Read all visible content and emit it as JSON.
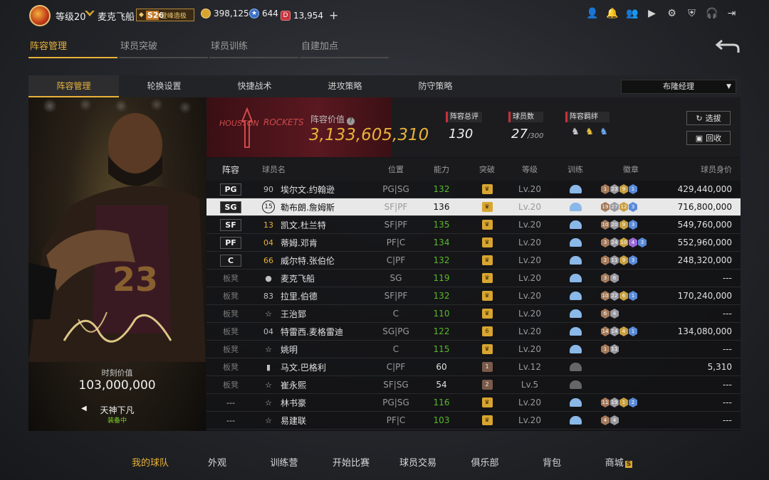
{
  "user": {
    "level": "等级20",
    "nickname": "麦克飞船",
    "season_num": "S26",
    "season_label": "登峰造极"
  },
  "currency": {
    "gold": "398,125",
    "stars": "644",
    "ruby": "13,954"
  },
  "main_tabs": [
    "阵容管理",
    "球员突破",
    "球员训练",
    "自建加点"
  ],
  "sub_tabs": [
    "阵容管理",
    "轮换设置",
    "快捷战术",
    "进攻策略",
    "防守策略"
  ],
  "coach_select": "布隆经理",
  "card": {
    "value_label": "时刻价值",
    "value": "103,000,000",
    "name": "天神下凡",
    "status": "装备中",
    "jersey": "23"
  },
  "team": {
    "logo_left": "HOUSTON",
    "logo_right": "ROCKETS",
    "lineup_label": "阵容价值",
    "lineup_value": "3,133,605,310",
    "rating_label": "阵容总评",
    "rating": "130",
    "count_label": "球员数",
    "count": "27",
    "count_max": "/300",
    "bond_label": "阵容羁绊",
    "btn_pick": "选拔",
    "btn_recycle": "回收"
  },
  "columns": [
    "阵容",
    "球员名",
    "位置",
    "能力",
    "突破",
    "等级",
    "训练",
    "徽章",
    "球员身价"
  ],
  "players": [
    {
      "slot": "PG",
      "num": "90",
      "name": "埃尔文.约翰逊",
      "pos": "PG|SG",
      "ability": "132",
      "ab_color": "green",
      "level": "Lv.20",
      "badges": [
        [
          "b",
          "1"
        ],
        [
          "s",
          "23"
        ],
        [
          "g",
          "9"
        ],
        [
          "h",
          "1"
        ]
      ],
      "value": "429,440,000"
    },
    {
      "slot": "SG",
      "num": "15",
      "name": "勒布朗.詹姆斯",
      "pos": "SF|PF",
      "ability": "136",
      "ab_color": "white",
      "level": "Lv.20",
      "badges": [
        [
          "b",
          "19"
        ],
        [
          "s",
          "27"
        ],
        [
          "g",
          "12"
        ],
        [
          "h",
          "3"
        ]
      ],
      "value": "716,800,000"
    },
    {
      "slot": "SF",
      "num": "13",
      "name": "凯文.杜兰特",
      "pos": "SF|PF",
      "ability": "135",
      "ab_color": "green",
      "level": "Lv.20",
      "badges": [
        [
          "b",
          "10"
        ],
        [
          "s",
          "20"
        ],
        [
          "g",
          "9"
        ],
        [
          "h",
          "3"
        ]
      ],
      "value": "549,760,000"
    },
    {
      "slot": "PF",
      "num": "04",
      "name": "蒂姆.邓肯",
      "pos": "PF|C",
      "ability": "134",
      "ab_color": "green",
      "level": "Lv.20",
      "badges": [
        [
          "b",
          "3"
        ],
        [
          "s",
          "24"
        ],
        [
          "g",
          "10"
        ],
        [
          "p",
          "4"
        ],
        [
          "h",
          "3"
        ]
      ],
      "value": "552,960,000"
    },
    {
      "slot": "C",
      "num": "66",
      "name": "威尔特.张伯伦",
      "pos": "C|PF",
      "ability": "132",
      "ab_color": "green",
      "level": "Lv.20",
      "badges": [
        [
          "b",
          "2"
        ],
        [
          "s",
          "11"
        ],
        [
          "g",
          "9"
        ],
        [
          "h",
          "3"
        ]
      ],
      "value": "248,320,000"
    },
    {
      "slot": "板凳",
      "num": "",
      "name": "麦克飞船",
      "pos": "SG",
      "ability": "119",
      "ab_color": "green",
      "level": "Lv.20",
      "badges": [
        [
          "b",
          "3"
        ],
        [
          "s",
          "6"
        ]
      ],
      "value": "---"
    },
    {
      "slot": "板凳",
      "num": "83",
      "name": "拉里.伯德",
      "pos": "SF|PF",
      "ability": "132",
      "ab_color": "green",
      "level": "Lv.20",
      "badges": [
        [
          "b",
          "10"
        ],
        [
          "s",
          "22"
        ],
        [
          "g",
          "6"
        ],
        [
          "h",
          "1"
        ]
      ],
      "value": "170,240,000"
    },
    {
      "slot": "板凳",
      "num": "",
      "name": "王治郅",
      "pos": "C",
      "ability": "110",
      "ab_color": "green",
      "level": "Lv.20",
      "badges": [
        [
          "b",
          "6"
        ],
        [
          "s",
          "4"
        ]
      ],
      "value": "---"
    },
    {
      "slot": "板凳",
      "num": "04",
      "name": "特雷西.麦格雷迪",
      "pos": "SG|PG",
      "ability": "122",
      "ab_color": "green",
      "level": "Lv.20",
      "break": "6",
      "badges": [
        [
          "b",
          "14"
        ],
        [
          "s",
          "14"
        ],
        [
          "g",
          "4"
        ],
        [
          "h",
          "1"
        ]
      ],
      "value": "134,080,000"
    },
    {
      "slot": "板凳",
      "num": "",
      "name": "姚明",
      "pos": "C",
      "ability": "115",
      "ab_color": "green",
      "level": "Lv.20",
      "badges": [
        [
          "b",
          "1"
        ],
        [
          "s",
          "11"
        ]
      ],
      "value": "---"
    },
    {
      "slot": "板凳",
      "num": "",
      "name": "马文.巴格利",
      "pos": "C|PF",
      "ability": "60",
      "ab_color": "white",
      "level": "Lv.12",
      "break": "1",
      "badges": [],
      "value": "5,310"
    },
    {
      "slot": "板凳",
      "num": "",
      "name": "崔永熙",
      "pos": "SF|SG",
      "ability": "54",
      "ab_color": "white",
      "level": "Lv.5",
      "break": "2",
      "badges": [],
      "value": "---"
    },
    {
      "slot": "---",
      "num": "",
      "name": "林书豪",
      "pos": "PG|SG",
      "ability": "116",
      "ab_color": "green",
      "level": "Lv.20",
      "badges": [
        [
          "b",
          "11"
        ],
        [
          "s",
          "19"
        ],
        [
          "g",
          "1"
        ],
        [
          "h",
          "2"
        ]
      ],
      "value": "---"
    },
    {
      "slot": "---",
      "num": "",
      "name": "易建联",
      "pos": "PF|C",
      "ability": "103",
      "ab_color": "green",
      "level": "Lv.20",
      "badges": [
        [
          "b",
          "4"
        ],
        [
          "s",
          "4"
        ]
      ],
      "value": "---"
    }
  ],
  "bottom_nav": [
    "我的球队",
    "外观",
    "训练营",
    "开始比赛",
    "球员交易",
    "俱乐部",
    "背包",
    "商城"
  ],
  "shop_badge": "S"
}
